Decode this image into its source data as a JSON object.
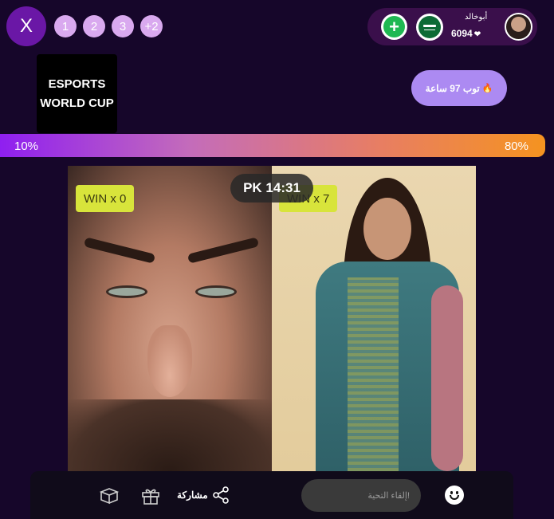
{
  "header": {
    "close_label": "X",
    "pages": [
      "1",
      "2",
      "3",
      "+2"
    ]
  },
  "profile": {
    "name": "أبوخالد",
    "score": "6094",
    "heart": "❤",
    "add_icon": "plus-icon",
    "flag_icon": "saudi-flag-icon"
  },
  "banner": {
    "line1": "ESPORTS",
    "line2": "WORLD CUP"
  },
  "top_button": {
    "label": "توب 97 ساعة"
  },
  "progress": {
    "left_percent": "10%",
    "right_percent": "80%"
  },
  "battle": {
    "left_win": "WIN x 0",
    "right_win": "WIN x 7",
    "timer": "PK 14:31"
  },
  "bottom": {
    "share_label": "مشاركة",
    "message_placeholder": "إلقاء التحية!",
    "colors": {
      "accent": "#6a17a6",
      "progress_start": "#8f1ff0",
      "progress_end": "#f59320"
    }
  }
}
